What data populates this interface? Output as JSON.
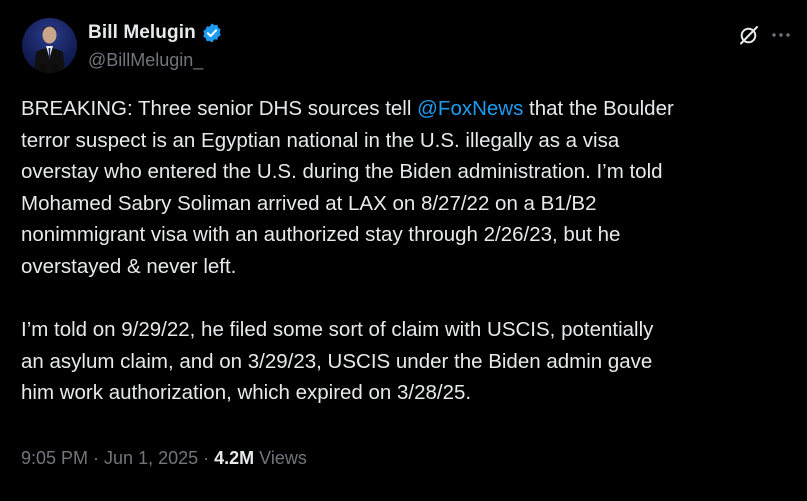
{
  "author": {
    "display_name": "Bill Melugin",
    "handle": "@BillMelugin_",
    "verified_color": "#1d9bf0"
  },
  "icons": {
    "avatar": "avatar",
    "verified": "verified-badge-icon",
    "grok": "grok-icon",
    "more": "more-icon"
  },
  "tweet": {
    "para1_lines": [
      "BREAKING: Three senior DHS sources tell ",
      "@FoxNews",
      " that the Boulder",
      "terror suspect is an Egyptian national in the U.S. illegally as a visa",
      "overstay who entered the U.S. during the Biden administration. I’m told",
      "Mohamed Sabry Soliman arrived at LAX on 8/27/22 on a B1/B2",
      "nonimmigrant visa with an authorized stay through 2/26/23, but he",
      "overstayed & never left."
    ],
    "para2_lines": [
      "I’m told on 9/29/22, he filed some sort of claim with USCIS, potentially",
      "an asylum claim, and on 3/29/23, USCIS under the Biden admin gave",
      "him work authorization, which expired on 3/28/25."
    ]
  },
  "meta": {
    "time": "9:05 PM",
    "sep1": " · ",
    "date": "Jun 1, 2025",
    "sep2": " · ",
    "views_count": "4.2M",
    "views_label": " Views"
  },
  "colors": {
    "background": "#000000",
    "text": "#e7e9ea",
    "secondary": "#71767b",
    "link": "#1d9bf0"
  }
}
